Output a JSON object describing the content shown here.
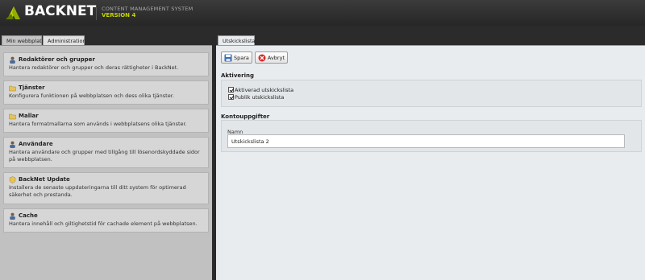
{
  "header": {
    "logo_text": "BACKNET",
    "cms_label": "CONTENT MANAGEMENT SYSTEM",
    "version_label": "VERSION 4"
  },
  "left_tabs": [
    "Min webbplats",
    "Administration"
  ],
  "admin_items": [
    {
      "title": "Redaktörer och grupper",
      "desc": "Hantera redaktörer och grupper och deras rättigheter i BackNet.",
      "icon": "user-icon"
    },
    {
      "title": "Tjänster",
      "desc": "Konfigurera funktionen på webbplatsen och dess olika tjänster.",
      "icon": "folder-icon"
    },
    {
      "title": "Mallar",
      "desc": "Hantera formatmallarna som används i webbplatsens olika tjänster.",
      "icon": "folder-icon"
    },
    {
      "title": "Användare",
      "desc": "Hantera användare och grupper med tillgång till lösenordskyddade sidor på webbplatsen.",
      "icon": "user-icon"
    },
    {
      "title": "BackNet Update",
      "desc": "Installera de senaste uppdateringarna till ditt system för optimerad säkerhet och prestanda.",
      "icon": "shield-icon"
    },
    {
      "title": "Cache",
      "desc": "Hantera innehåll och giltighetstid för cachade element på webbplatsen.",
      "icon": "user-icon"
    }
  ],
  "right_tab": "Utskickslista:",
  "toolbar": {
    "save_label": "Spara",
    "cancel_label": "Avbryt"
  },
  "aktivering": {
    "title": "Aktivering",
    "checkboxes": [
      {
        "label": "Aktiverad utskickslista",
        "checked": true
      },
      {
        "label": "Publik utskickslista",
        "checked": true
      }
    ]
  },
  "kontouppgifter": {
    "title": "Kontouppgifter",
    "name_label": "Namn",
    "name_value": "Utskickslista 2"
  }
}
